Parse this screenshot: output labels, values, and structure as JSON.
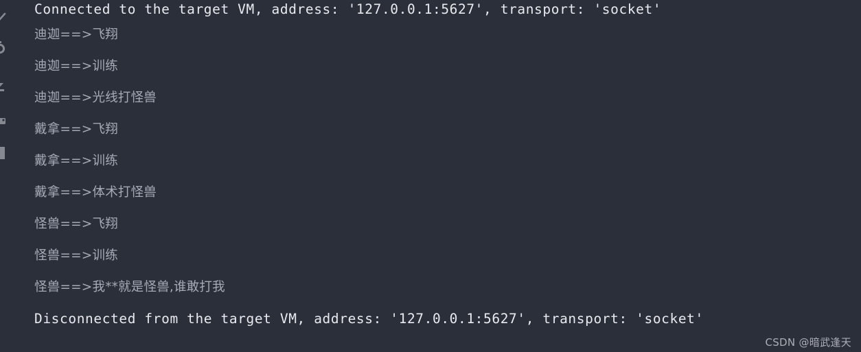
{
  "window": {
    "background_color": "#2b2f3a",
    "system_text_color": "#e8eaf0",
    "stdout_text_color": "#a6aab6"
  },
  "gutter": {
    "icons": [
      {
        "name": "rerun-icon",
        "label": "Rerun"
      },
      {
        "name": "restart-icon",
        "label": "Restart"
      },
      {
        "name": "thread-dump-icon",
        "label": "Thread Dump"
      },
      {
        "name": "settings-icon",
        "label": "Settings"
      },
      {
        "name": "print-icon",
        "label": "Print"
      }
    ]
  },
  "console": {
    "lines": [
      {
        "type": "system",
        "text": "Connected to the target VM, address: '127.0.0.1:5627', transport: 'socket'"
      },
      {
        "type": "stdout",
        "text": "迪迦==>飞翔"
      },
      {
        "type": "stdout",
        "text": "迪迦==>训练"
      },
      {
        "type": "stdout",
        "text": "迪迦==>光线打怪兽"
      },
      {
        "type": "stdout",
        "text": "戴拿==>飞翔"
      },
      {
        "type": "stdout",
        "text": "戴拿==>训练"
      },
      {
        "type": "stdout",
        "text": "戴拿==>体术打怪兽"
      },
      {
        "type": "stdout",
        "text": "怪兽==>飞翔"
      },
      {
        "type": "stdout",
        "text": "怪兽==>训练"
      },
      {
        "type": "stdout",
        "text": "怪兽==>我**就是怪兽,谁敢打我"
      },
      {
        "type": "system",
        "text": "Disconnected from the target VM, address: '127.0.0.1:5627', transport: 'socket'"
      }
    ]
  },
  "watermark": {
    "text": "CSDN @暗武逢天"
  }
}
